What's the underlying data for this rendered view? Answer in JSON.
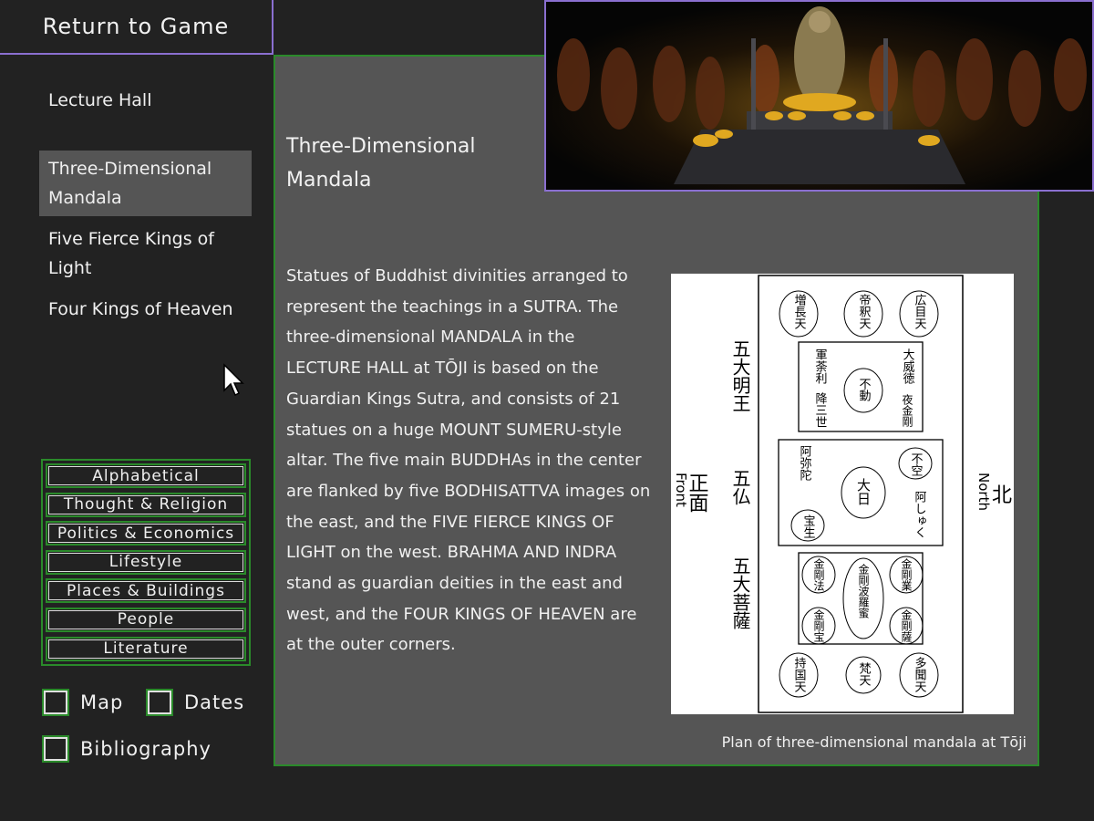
{
  "nav": {
    "return_label": "Return to Game",
    "topics": [
      {
        "label": "Lecture Hall"
      },
      {
        "label": "Three-Dimensional Mandala",
        "selected": true
      },
      {
        "label": "Five Fierce Kings of Light"
      },
      {
        "label": "Four Kings of Heaven"
      }
    ]
  },
  "categories": [
    "Alphabetical",
    "Thought & Religion",
    "Politics & Economics",
    "Lifestyle",
    "Places & Buildings",
    "People",
    "Literature"
  ],
  "options": {
    "map": "Map",
    "dates": "Dates",
    "bibliography": "Bibliography"
  },
  "article": {
    "title": "Three-Dimensional Mandala",
    "body": "Statues of Buddhist divinities arranged to represent the teachings in a SUTRA. The three-dimensional MANDALA in the LECTURE HALL at TŌJI is based on the Guardian Kings Sutra, and consists of 21 statues on a huge MOUNT SUMERU-style altar. The five main BUDDHAs in the center are flanked by five BODHISATTVA images on the east, and the FIVE FIERCE KINGS OF LIGHT on the west. BRAHMA AND INDRA stand as guardian deities in the east and west, and the FOUR KINGS OF HEAVEN are at the outer corners.",
    "caption": "Plan of three-dimensional mandala at Tōji"
  },
  "plan": {
    "front_jp": "正面",
    "front_en": "Front",
    "north_jp": "北",
    "north_en": "North",
    "group_labels": [
      "五大明王",
      "五仏",
      "五大菩薩"
    ],
    "corners": [
      "増長天",
      "帝釈天",
      "広目天",
      "持国天",
      "梵天",
      "多聞天"
    ],
    "kings": [
      "軍荼利",
      "不動",
      "大威徳",
      "降三世",
      "夜金剛"
    ],
    "buddhas": [
      "阿弥陀",
      "大日",
      "不空",
      "宝生",
      "阿しゅく"
    ],
    "bodhisattvas": [
      "金剛法",
      "金剛波羅蜜",
      "金剛業",
      "金剛宝",
      "金剛薩"
    ]
  },
  "colors": {
    "accent_purple": "#8a6fd0",
    "accent_green": "#2a8a2a",
    "panel_gray": "#555555",
    "background": "#222222"
  }
}
